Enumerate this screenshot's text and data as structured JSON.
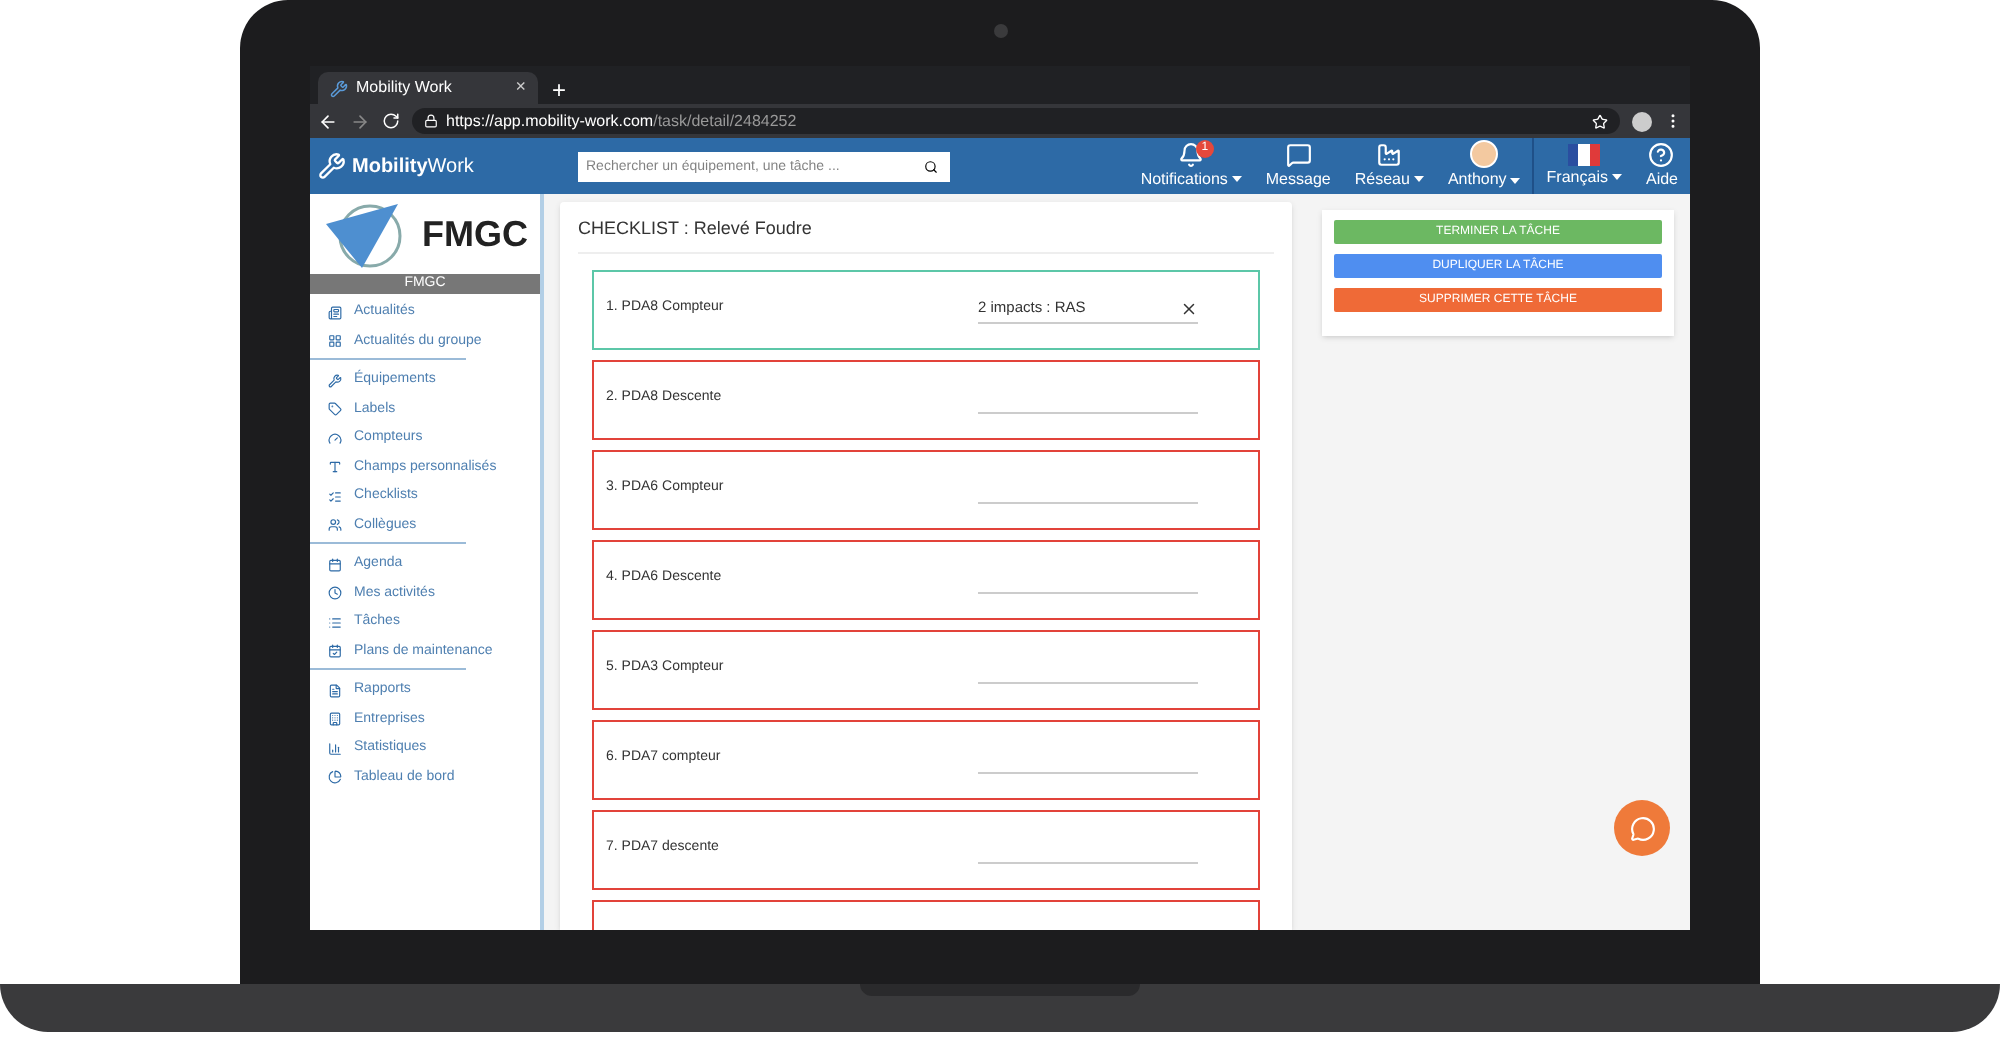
{
  "browser": {
    "tab_title": "Mobility Work",
    "new_tab": "+",
    "close_tab": "×",
    "url_host": "https://app.mobility-work.com",
    "url_path": "/task/detail/2484252"
  },
  "header": {
    "logo": {
      "bold": "Mobility",
      "rest": "Work"
    },
    "search": {
      "placeholder": "Rechercher un équipement, une tâche ..."
    },
    "nav": [
      {
        "label": "Notifications",
        "badge": "1",
        "dropdown": true
      },
      {
        "label": "Message",
        "dropdown": false
      },
      {
        "label": "Réseau",
        "dropdown": true
      },
      {
        "label": "Anthony",
        "dropdown": true
      },
      {
        "label": "Français",
        "dropdown": true
      },
      {
        "label": "Aide",
        "dropdown": false
      }
    ]
  },
  "sidebar": {
    "company": "FMGC",
    "company_caption": "FMGC",
    "groups": [
      [
        "Actualités",
        "Actualités du groupe"
      ],
      [
        "Équipements",
        "Labels",
        "Compteurs",
        "Champs personnalisés",
        "Checklists",
        "Collègues"
      ],
      [
        "Agenda",
        "Mes activités",
        "Tâches",
        "Plans de maintenance"
      ],
      [
        "Rapports",
        "Entreprises",
        "Statistiques",
        "Tableau de bord"
      ]
    ]
  },
  "checklist": {
    "title": "CHECKLIST : Relevé Foudre",
    "items": [
      {
        "label": "1. PDA8 Compteur",
        "value": "2 impacts : RAS",
        "filled": true
      },
      {
        "label": "2. PDA8 Descente",
        "filled": false
      },
      {
        "label": "3. PDA6 Compteur",
        "filled": false
      },
      {
        "label": "4. PDA6 Descente",
        "filled": false
      },
      {
        "label": "5. PDA3 Compteur",
        "filled": false
      },
      {
        "label": "6. PDA7 compteur",
        "filled": false
      },
      {
        "label": "7. PDA7 descente",
        "filled": false
      },
      {
        "filled": false
      }
    ]
  },
  "actions": [
    {
      "label": "TERMINER LA TÂCHE",
      "color": "#6cb862"
    },
    {
      "label": "DUPLIQUER LA TÂCHE",
      "color": "#4f8ef0"
    },
    {
      "label": "SUPPRIMER CETTE TÂCHE",
      "color": "#ef6a37"
    }
  ]
}
